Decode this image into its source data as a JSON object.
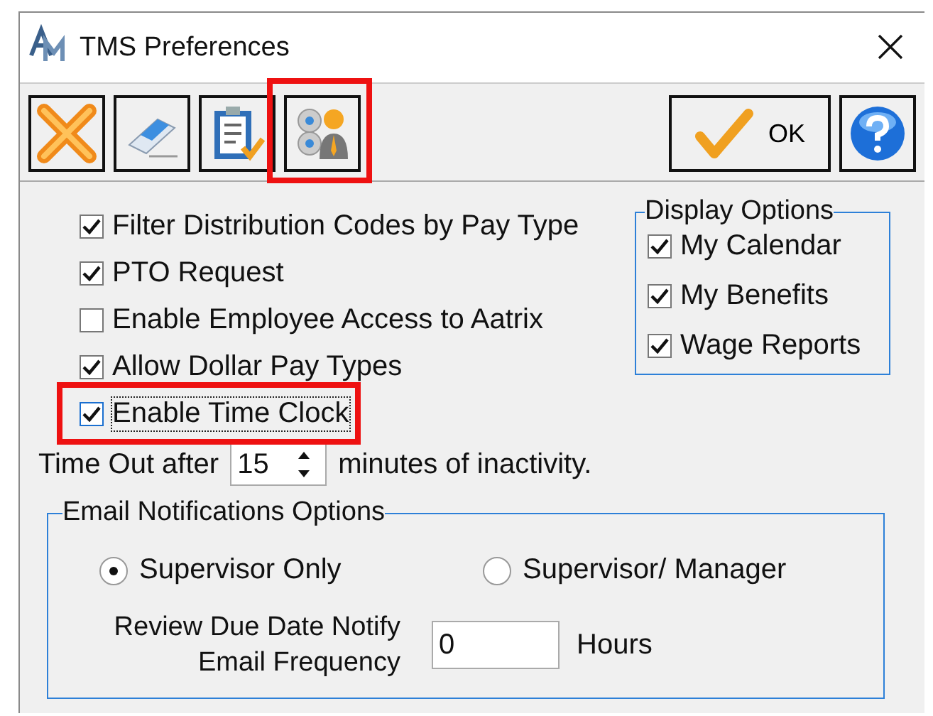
{
  "window": {
    "title": "TMS Preferences"
  },
  "toolbar": [
    {
      "kind": "cancel",
      "highlighted": false
    },
    {
      "kind": "eraser",
      "highlighted": false
    },
    {
      "kind": "clipboard",
      "highlighted": false
    },
    {
      "kind": "people",
      "highlighted": true
    },
    {
      "kind": "ok",
      "label": "OK",
      "highlighted": false
    },
    {
      "kind": "help",
      "highlighted": false
    }
  ],
  "options": [
    {
      "label": "Filter Distribution Codes by Pay Type",
      "checked": true,
      "focused": false,
      "highlighted": false
    },
    {
      "label": "PTO Request",
      "checked": true,
      "focused": false,
      "highlighted": false
    },
    {
      "label": "Enable Employee Access to Aatrix",
      "checked": false,
      "focused": false,
      "highlighted": false
    },
    {
      "label": "Allow Dollar Pay Types",
      "checked": true,
      "focused": false,
      "highlighted": false
    },
    {
      "label": "Enable Time Clock",
      "checked": true,
      "focused": true,
      "highlighted": true
    }
  ],
  "display_options": {
    "title": "Display Options",
    "items": [
      {
        "label": "My Calendar",
        "checked": true
      },
      {
        "label": "My Benefits",
        "checked": true
      },
      {
        "label": "Wage Reports",
        "checked": true
      }
    ]
  },
  "timeout": {
    "label": "Time Out after",
    "value": "15",
    "suffix": "minutes of inactivity."
  },
  "email": {
    "title": "Email Notifications Options",
    "recipients": [
      {
        "label": "Supervisor Only",
        "selected": true
      },
      {
        "label": "Supervisor/ Manager",
        "selected": false
      }
    ],
    "frequency": {
      "label": "Review Due Date Notify Email Frequency",
      "value": "0",
      "unit": "Hours"
    }
  }
}
